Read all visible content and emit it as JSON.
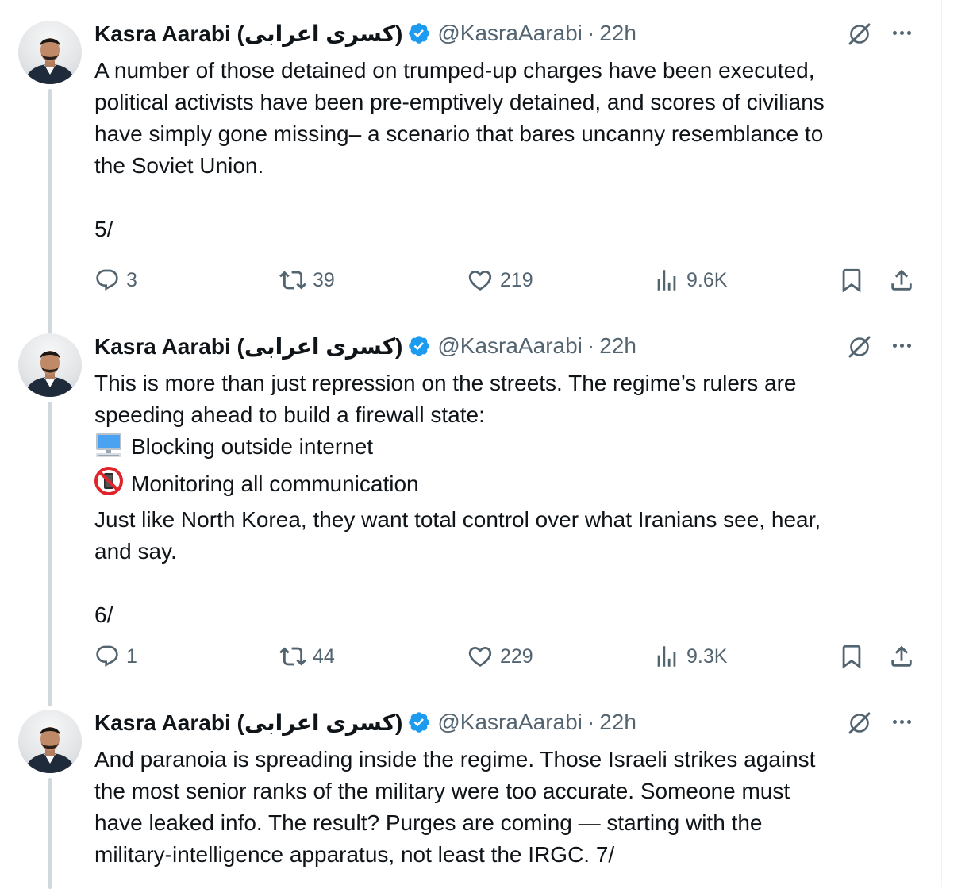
{
  "tweets": [
    {
      "author_name": "Kasra Aarabi (کسری اعرابی)",
      "handle": "@KasraAarabi",
      "separator": "·",
      "time": "22h",
      "lines": [
        "A number of those detained on trumped-up charges have been executed,",
        "political activists have been pre-emptively detained, and scores of civilians",
        "have simply gone missing– a scenario that bares uncanny resemblance to",
        "the Soviet Union.",
        "",
        "5/"
      ],
      "replies": "3",
      "reposts": "39",
      "likes": "219",
      "views": "9.6K"
    },
    {
      "author_name": "Kasra Aarabi (کسری اعرابی)",
      "handle": "@KasraAarabi",
      "separator": "·",
      "time": "22h",
      "lines": [
        "This is more than just repression on the streets. The regime’s rulers are",
        "speeding ahead to build a firewall state:",
        "Blocking outside internet",
        "Monitoring all communication",
        "Just like North Korea, they want total control over what Iranians see, hear,",
        "and say.",
        "",
        "6/"
      ],
      "line_icons": [
        "",
        "",
        "desktop-computer-emoji",
        "no-mobile-phones-emoji",
        "",
        "",
        "",
        ""
      ],
      "replies": "1",
      "reposts": "44",
      "likes": "229",
      "views": "9.3K"
    },
    {
      "author_name": "Kasra Aarabi (کسری اعرابی)",
      "handle": "@KasraAarabi",
      "separator": "·",
      "time": "22h",
      "lines": [
        "And paranoia is spreading inside the regime. Those Israeli strikes against",
        "the most senior ranks of the military were too accurate. Someone must",
        "have leaked info. The result? Purges are coming — starting with the",
        "military-intelligence apparatus, not least the IRGC. 7/"
      ]
    }
  ],
  "colors": {
    "text": "#0f1419",
    "secondary": "#536471",
    "verified": "#1d9bf0",
    "thread_line": "#cfd9de"
  }
}
